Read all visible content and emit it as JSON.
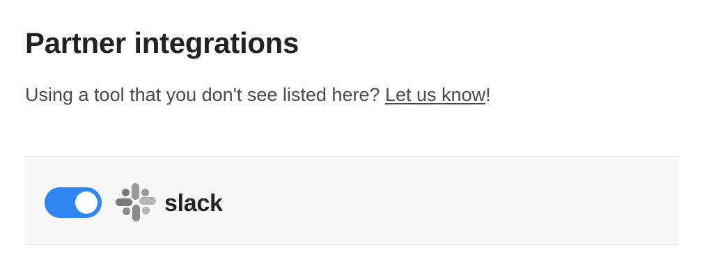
{
  "header": {
    "title": "Partner integrations"
  },
  "intro": {
    "text_before": "Using a tool that you don't see listed here? ",
    "link_label": "Let us know",
    "text_after": "!"
  },
  "integrations": [
    {
      "name": "slack",
      "enabled": true,
      "icon": "slack-icon",
      "toggle_color": "#2f86f2"
    }
  ]
}
